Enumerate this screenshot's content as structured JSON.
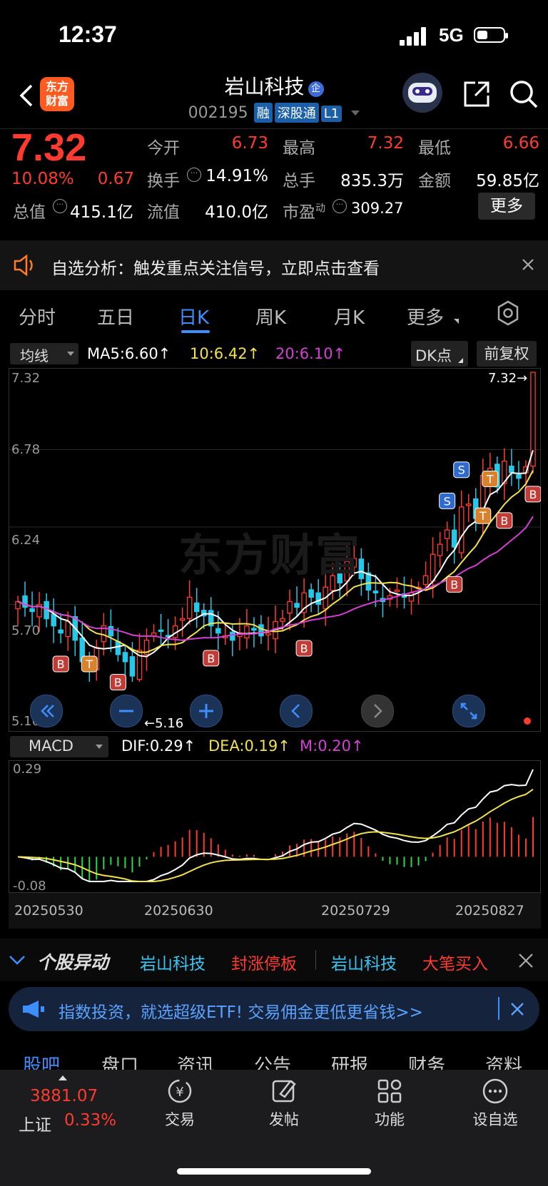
{
  "status": {
    "time": "12:37",
    "network": "5G"
  },
  "header": {
    "title": "岩山科技",
    "code": "002195",
    "tags": [
      "融",
      "深股通",
      "L1"
    ],
    "logo_text": "东方财富"
  },
  "quote": {
    "price": "7.32",
    "change_pct": "10.08%",
    "change": "0.67",
    "open_label": "今开",
    "open": "6.73",
    "high_label": "最高",
    "high": "7.32",
    "low_label": "最低",
    "low": "6.66",
    "turnover_label": "换手",
    "turnover": "14.91%",
    "volume_label": "总手",
    "volume": "835.3万",
    "amount_label": "金额",
    "amount": "59.85亿",
    "mktcap_label": "总值",
    "mktcap": "415.1亿",
    "float_label": "流值",
    "float": "410.0亿",
    "pe_label": "市盈",
    "pe_sup": "动",
    "pe": "309.27",
    "more": "更多"
  },
  "notice": {
    "text": "自选分析：触发重点关注信号，立即点击查看"
  },
  "tabs": [
    "分时",
    "五日",
    "日K",
    "周K",
    "月K",
    "更多"
  ],
  "chart_controls": {
    "indicator": "均线",
    "ma5": "MA5:6.60↑",
    "ma10": "10:6.42↑",
    "ma20": "20:6.10↑",
    "dk": "DK点",
    "adjust": "前复权"
  },
  "chart_data": [
    {
      "type": "candlestick",
      "y_ticks": [
        "7.32",
        "6.78",
        "6.24",
        "5.70",
        "5.16"
      ],
      "ylim": [
        5.16,
        7.32
      ],
      "max_label": "7.32→",
      "min_label": "←5.16",
      "watermark": "东方财富",
      "signals": [
        "B",
        "T",
        "B",
        "B",
        "B",
        "S",
        "B",
        "T",
        "T",
        "B",
        "B",
        "S"
      ],
      "closes": [
        5.72,
        5.68,
        5.65,
        5.7,
        5.6,
        5.55,
        5.5,
        5.58,
        5.45,
        5.3,
        5.25,
        5.4,
        5.55,
        5.48,
        5.35,
        5.3,
        5.2,
        5.38,
        5.45,
        5.5,
        5.52,
        5.48,
        5.55,
        5.6,
        5.75,
        5.65,
        5.62,
        5.55,
        5.5,
        5.48,
        5.45,
        5.5,
        5.55,
        5.52,
        5.48,
        5.5,
        5.58,
        5.6,
        5.72,
        5.68,
        5.78,
        5.75,
        5.7,
        5.82,
        5.9,
        5.85,
        6.0,
        6.02,
        5.88,
        5.8,
        5.78,
        5.72,
        5.76,
        5.8,
        5.75,
        5.78,
        5.82,
        5.9,
        6.05,
        6.12,
        6.22,
        6.1,
        6.38,
        6.4,
        6.3,
        6.6,
        6.65,
        6.52,
        6.7,
        6.62,
        6.58,
        6.66,
        7.32
      ]
    },
    {
      "type": "macd",
      "indicator": "MACD",
      "dif": "DIF:0.29↑",
      "dea": "DEA:0.19↑",
      "m": "M:0.20↑",
      "y_ticks": [
        "0.29",
        "-0.08"
      ],
      "ylim": [
        -0.08,
        0.29
      ],
      "x_labels": [
        "20250530",
        "20250630",
        "20250729",
        "20250827"
      ]
    }
  ],
  "ticker": {
    "title": "个股异动",
    "items": [
      {
        "name": "岩山科技",
        "event": "封涨停板"
      },
      {
        "name": "岩山科技",
        "event": "大笔买入"
      }
    ]
  },
  "ad": {
    "text": "指数投资，就选超级ETF! 交易佣金更低更省钱>>"
  },
  "subtabs": [
    "股吧",
    "盘口",
    "资讯",
    "公告",
    "研报",
    "财务",
    "资料"
  ],
  "bottom": {
    "index_value": "3881.07",
    "index_name": "上证",
    "index_pct": "0.33%",
    "items": [
      "交易",
      "发帖",
      "功能",
      "设自选"
    ]
  },
  "colors": {
    "up": "#ff3b30",
    "down": "#25c8e8",
    "ma5": "#ffffff",
    "ma10": "#f2e14c",
    "ma20": "#d63fd6",
    "accent": "#3d8eff"
  }
}
